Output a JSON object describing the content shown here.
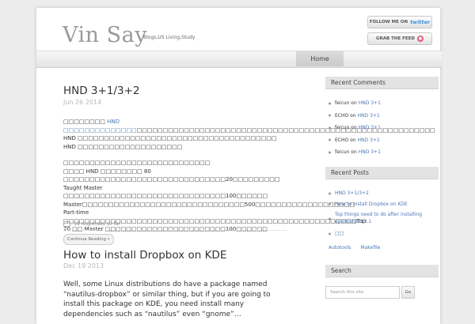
{
  "site": {
    "title": "Vin Say",
    "description": "Blogs,US Living,Study"
  },
  "header_badges": {
    "twitter_prefix": "FOLLOW ME ON",
    "twitter_brand": "twitter",
    "feed_label": "GRAB THE FEED"
  },
  "nav": {
    "home_label": "Home"
  },
  "posts": [
    {
      "title": "HND 3+1/3+2",
      "date": "Jun 26 2014",
      "para1_prefix": "□□□□□□□□ ",
      "para1_link": "HND □□□□□□□□□□□□□□",
      "para1_rest": "□□□□□□□□□□□□□□□□□□□□□□□□□□□□□□□□□□□□□□□□□□□□□□□□□□□□□□□□□ HND □□□□□□□□□□□□□□□□□□□□□□□□□□□□□□□□□□□□□□ HND □□□□□□□□□□□□□□□□□□□□",
      "para2_line1": "□□□□□□□□□□□□□□□□□□□□□□□□□□□□",
      "para2_body": "□□□□ HND □□□□□□□□ 80 □□□□□□□□□□□□□□□□□□□□□□□□□□□□□□□20□□□□□□□□□ Taught Master □□□□□□□□□□□□□□□□□□□□□□□□□□□□□□□100□□□□□□ Master□□□□□□□□□□□□□□□□□□□□□□□□□□□□□□□500□□□□□□□□□□□□□□□□□□□ Part-time □□□□□□□□□□□□□□□□□□□□□□□□□□□□□□□□□□□□□□□□□□□□□□□□□□□□□□□□Top 20 □□ Master □□□□□□□□□□□□□□□□□□□□□□□100□□□□□□",
      "continue_label": "Continue Reading »",
      "responses": "18 responses so far"
    },
    {
      "title": "How to install Dropbox on KDE",
      "date": "Dec 19 2013",
      "excerpt": "Well, some Linux distributions do have a package named “nautilus-dropbox” or similar thing, but if you are going to install this package on KDE, you need install many dependencies such as “nautilus” even “gnome”…"
    }
  ],
  "sidebar": {
    "recent_comments": {
      "heading": "Recent Comments",
      "items": [
        {
          "author": "feicun",
          "on": "on",
          "target": "HND 3+1"
        },
        {
          "author": "ECHO",
          "on": "on",
          "target": "HND 3+1"
        },
        {
          "author": "feicun",
          "on": "on",
          "target": "HND 3+1"
        },
        {
          "author": "ECHO",
          "on": "on",
          "target": "HND 3+1"
        },
        {
          "author": "feicun",
          "on": "on",
          "target": "HND 3+1"
        }
      ]
    },
    "recent_posts": {
      "heading": "Recent Posts",
      "items": [
        "HND 3+1/3+2",
        "How to install Dropbox on KDE",
        "Top things need to do after installing openSUSE 13.1",
        "□□"
      ]
    },
    "tags": [
      "Autotools",
      "Makefile"
    ],
    "search": {
      "heading": "Search",
      "placeholder": "Search this site",
      "button_label": "Go"
    }
  }
}
